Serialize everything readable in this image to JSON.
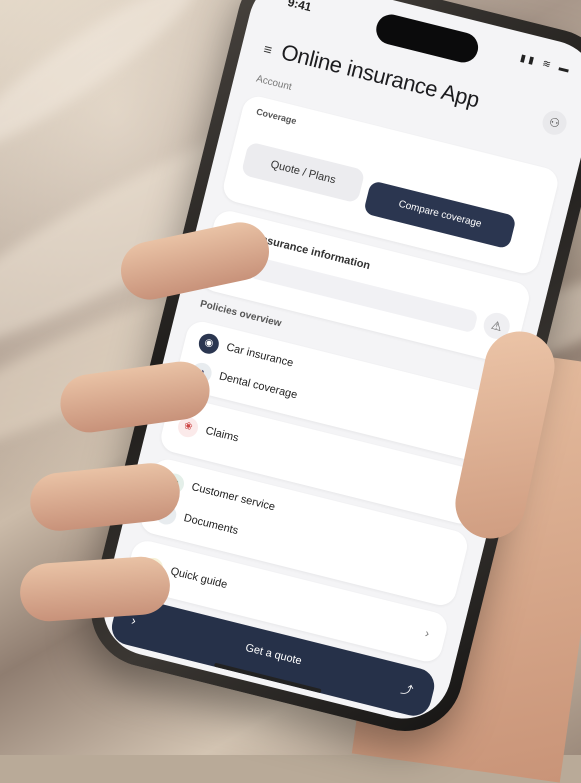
{
  "status_bar": {
    "time": "9:41",
    "icons": "▮▮ ≋ ▬"
  },
  "header": {
    "menu_icon": "≡",
    "title": "Online insurance App",
    "profile_icon": "⚇"
  },
  "subtitle": "Account",
  "coverage_card": {
    "label": "Coverage",
    "hint": "",
    "option_light": "Quote / Plans",
    "option_dark": "Compare coverage"
  },
  "search_card": {
    "doc_icon": "▤",
    "title": "Insurance information",
    "input_placeholder": "",
    "alert_icon": "⚠"
  },
  "section": {
    "label": "Policies overview"
  },
  "policies": [
    {
      "icon": "◉",
      "label": "Car insurance",
      "sub": ""
    },
    {
      "icon": "◔",
      "label": "Dental coverage",
      "sub": ""
    }
  ],
  "claims": {
    "icon": "❀",
    "label": "Claims",
    "right": ""
  },
  "services": [
    {
      "icon": "✿",
      "label": "Customer service",
      "sub": ""
    },
    {
      "icon": "◐",
      "label": "Documents",
      "sub": ""
    }
  ],
  "quick": {
    "icon": "◑",
    "label": "Quick guide",
    "right": ""
  },
  "bottom_bar": {
    "left": "›",
    "label": "Get a quote",
    "right": "⤴"
  },
  "colors": {
    "primary": "#263149",
    "accent": "#e9c441",
    "background": "#f4f4f6"
  }
}
